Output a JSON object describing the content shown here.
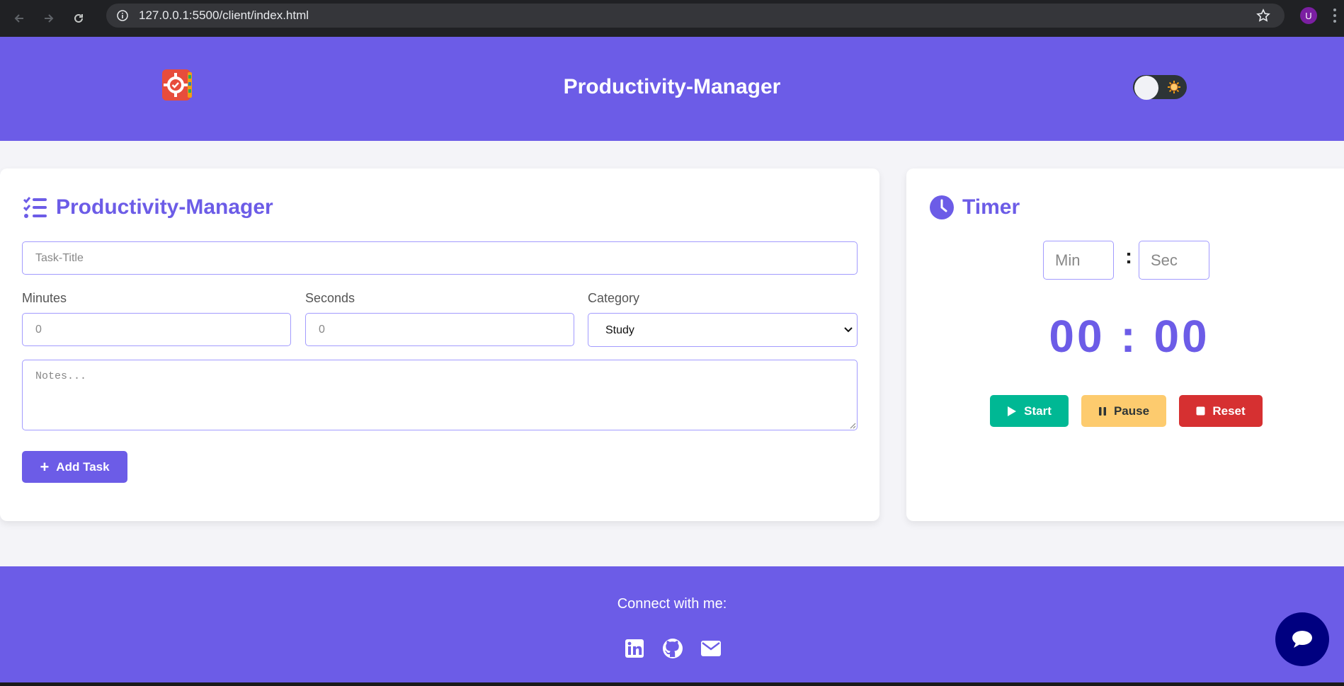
{
  "browser": {
    "url": "127.0.0.1:5500/client/index.html",
    "profile_initial": "U"
  },
  "header": {
    "title": "Productivity-Manager",
    "logo_icon": "productivity-gear-book-logo",
    "theme_toggle_icon": "sun-icon"
  },
  "task_form": {
    "title": "Productivity-Manager",
    "title_icon": "checklist-icon",
    "task_title_placeholder": "Task-Title",
    "minutes_label": "Minutes",
    "minutes_placeholder": "0",
    "seconds_label": "Seconds",
    "seconds_placeholder": "0",
    "category_label": "Category",
    "category_selected": "Study",
    "notes_placeholder": "Notes...",
    "add_button_label": "Add Task"
  },
  "timer": {
    "title": "Timer",
    "title_icon": "clock-icon",
    "min_placeholder": "Min",
    "sec_placeholder": "Sec",
    "separator": ":",
    "display": "00 : 00",
    "start_label": "Start",
    "pause_label": "Pause",
    "reset_label": "Reset"
  },
  "footer": {
    "connect_text": "Connect with me:",
    "social_icons": [
      "linkedin-icon",
      "github-icon",
      "email-icon"
    ]
  },
  "colors": {
    "brand": "#6c5ce7",
    "start": "#00b894",
    "pause": "#fdcb6e",
    "reset": "#d63031",
    "chat_fab": "#000080"
  }
}
